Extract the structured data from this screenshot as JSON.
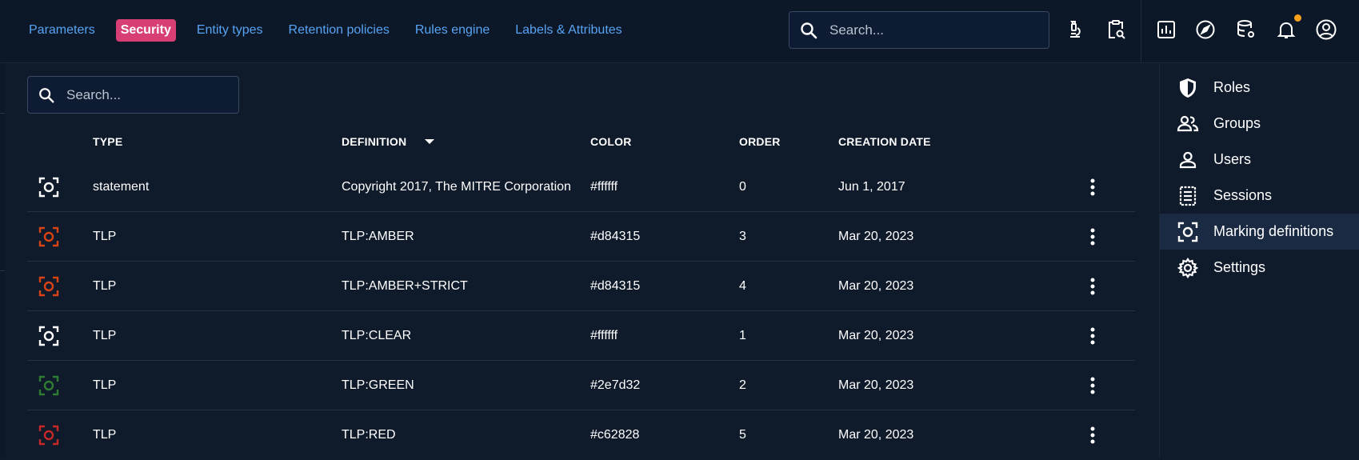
{
  "nav": {
    "tabs": [
      {
        "label": "Parameters",
        "active": false
      },
      {
        "label": "Security",
        "active": true
      },
      {
        "label": "Entity types",
        "active": false
      },
      {
        "label": "Retention policies",
        "active": false
      },
      {
        "label": "Rules engine",
        "active": false
      },
      {
        "label": "Labels & Attributes",
        "active": false
      }
    ]
  },
  "top_search": {
    "placeholder": "Search..."
  },
  "top_icons": [
    "microscope-icon",
    "clipboard-search-icon",
    "dashboard-chart-icon",
    "compass-icon",
    "database-settings-icon",
    "bell-icon",
    "account-circle-icon"
  ],
  "content_search": {
    "placeholder": "Search..."
  },
  "table": {
    "headers": {
      "type": "TYPE",
      "definition": "DEFINITION",
      "color": "COLOR",
      "order": "ORDER",
      "creation_date": "CREATION DATE"
    },
    "rows": [
      {
        "type": "statement",
        "definition": "Copyright 2017, The MITRE Corporation",
        "color": "#ffffff",
        "order": "0",
        "date": "Jun 1, 2017"
      },
      {
        "type": "TLP",
        "definition": "TLP:AMBER",
        "color": "#d84315",
        "order": "3",
        "date": "Mar 20, 2023"
      },
      {
        "type": "TLP",
        "definition": "TLP:AMBER+STRICT",
        "color": "#d84315",
        "order": "4",
        "date": "Mar 20, 2023"
      },
      {
        "type": "TLP",
        "definition": "TLP:CLEAR",
        "color": "#ffffff",
        "order": "1",
        "date": "Mar 20, 2023"
      },
      {
        "type": "TLP",
        "definition": "TLP:GREEN",
        "color": "#2e7d32",
        "order": "2",
        "date": "Mar 20, 2023"
      },
      {
        "type": "TLP",
        "definition": "TLP:RED",
        "color": "#c62828",
        "order": "5",
        "date": "Mar 20, 2023"
      }
    ]
  },
  "sidebar": {
    "items": [
      {
        "label": "Roles",
        "icon": "shield-icon",
        "active": false
      },
      {
        "label": "Groups",
        "icon": "groups-icon",
        "active": false
      },
      {
        "label": "Users",
        "icon": "user-icon",
        "active": false
      },
      {
        "label": "Sessions",
        "icon": "sessions-icon",
        "active": false
      },
      {
        "label": "Marking definitions",
        "icon": "marking-icon",
        "active": true
      },
      {
        "label": "Settings",
        "icon": "gear-icon",
        "active": false
      }
    ]
  },
  "colors": {
    "accent": "#57a4f5",
    "active_tab": "#d63e74",
    "background": "#0f1a2b",
    "notification": "#f7a21c"
  }
}
